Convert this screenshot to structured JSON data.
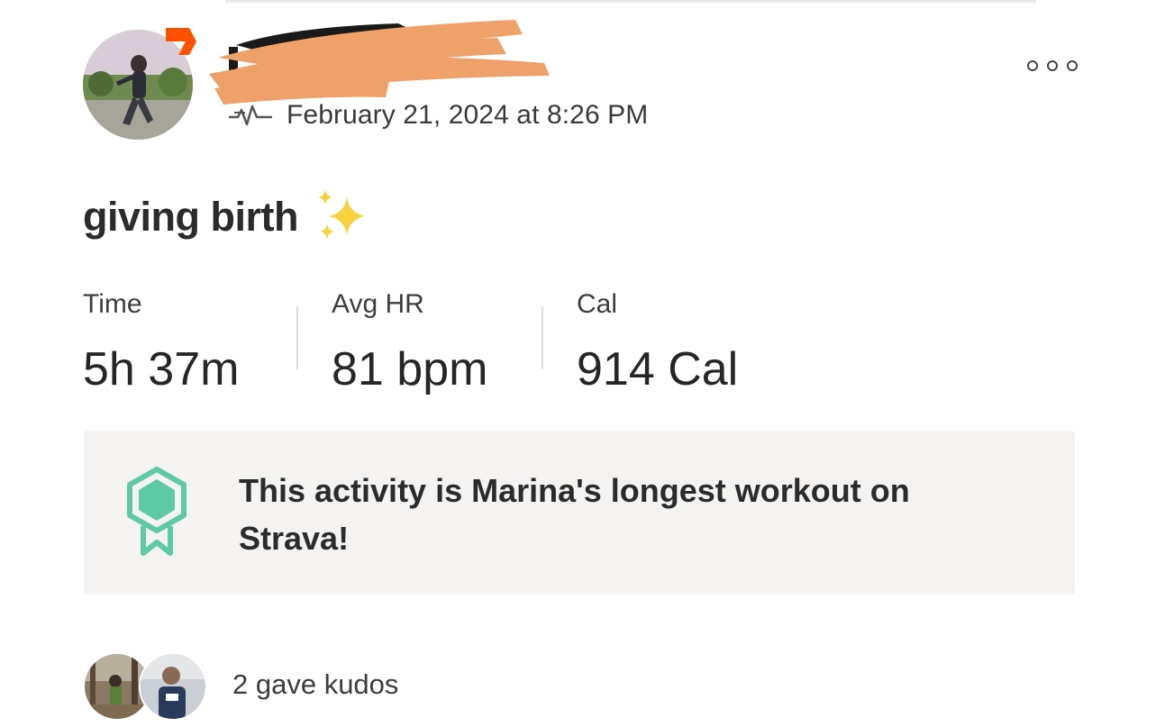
{
  "activity": {
    "date": "February 21, 2024 at 8:26 PM",
    "title": "giving birth",
    "title_emoji": "sparkles-icon",
    "more_icon": "more-options-icon",
    "type_icon": "heart-rate-icon"
  },
  "stats": [
    {
      "label": "Time",
      "value": "5h 37m"
    },
    {
      "label": "Avg HR",
      "value": "81 bpm"
    },
    {
      "label": "Cal",
      "value": "914 Cal"
    }
  ],
  "achievement": {
    "icon": "award-badge-icon",
    "text": "This activity is Marina's longest workout on Strava!"
  },
  "kudos": {
    "text": "2 gave kudos"
  },
  "colors": {
    "strava_orange": "#fc5200",
    "badge_green": "#5ec9a5",
    "redaction": "#efa16a",
    "panel_bg": "#f4f3f1"
  }
}
